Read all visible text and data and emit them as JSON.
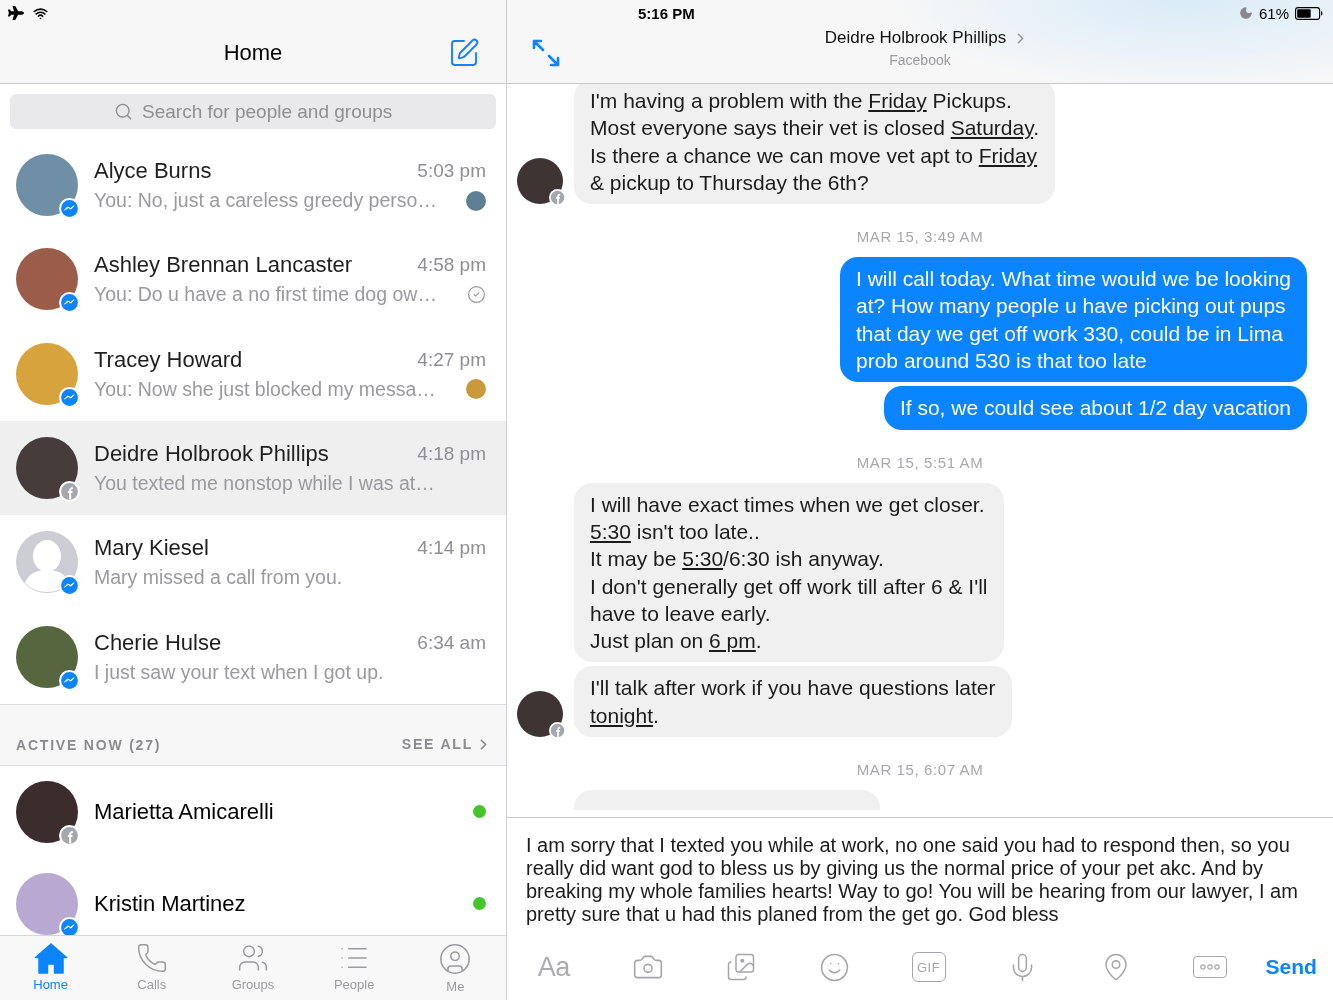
{
  "status_bar": {
    "time": "5:16 PM",
    "battery": "61%"
  },
  "sidebar": {
    "title": "Home",
    "search": {
      "placeholder": "Search for people and groups"
    },
    "conversations": [
      {
        "name": "Alyce Burns",
        "time": "5:03 pm",
        "preview": "You: No, just a careless greedy perso…",
        "photo": true,
        "facebook_user": false,
        "seen": true,
        "delivered": false,
        "selected": false
      },
      {
        "name": "Ashley Brennan Lancaster",
        "time": "4:58 pm",
        "preview": "You: Do u have a no first time dog ow…",
        "photo": true,
        "facebook_user": false,
        "seen": false,
        "delivered": true,
        "selected": false
      },
      {
        "name": "Tracey Howard",
        "time": "4:27 pm",
        "preview": "You: Now she just blocked my messa…",
        "photo": true,
        "facebook_user": false,
        "seen": true,
        "delivered": false,
        "selected": false
      },
      {
        "name": "Deidre Holbrook Phillips",
        "time": "4:18 pm",
        "preview": "You texted me nonstop while I was at…",
        "photo": true,
        "facebook_user": true,
        "seen": false,
        "delivered": false,
        "selected": true
      },
      {
        "name": "Mary Kiesel",
        "time": "4:14 pm",
        "preview": "Mary missed a call from you.",
        "photo": false,
        "facebook_user": false,
        "seen": false,
        "delivered": false,
        "selected": false
      },
      {
        "name": "Cherie Hulse",
        "time": "6:34 am",
        "preview": "I just saw your text when I got up.",
        "photo": true,
        "facebook_user": false,
        "seen": false,
        "delivered": false,
        "selected": false
      }
    ],
    "active_now": {
      "heading": "ACTIVE NOW (27)",
      "see_all": "SEE ALL",
      "people": [
        {
          "name": "Marietta Amicarelli",
          "photo": true,
          "facebook_user": true,
          "online": true
        },
        {
          "name": "Kristin Martinez",
          "photo": true,
          "facebook_user": false,
          "online": true
        }
      ]
    },
    "tabs": [
      {
        "label": "Home",
        "kind": "home",
        "selected": true
      },
      {
        "label": "Calls",
        "kind": "calls",
        "selected": false
      },
      {
        "label": "Groups",
        "kind": "groups",
        "selected": false
      },
      {
        "label": "People",
        "kind": "people",
        "selected": false
      },
      {
        "label": "Me",
        "kind": "me",
        "selected": false
      }
    ]
  },
  "chat": {
    "title": "Deidre Holbrook Phillips",
    "subtitle": "Facebook",
    "facebook_user": true,
    "messages": [
      {
        "kind": "incoming",
        "avatar": true,
        "parts": [
          {
            "text": "I'm having a problem with the ",
            "link": false
          },
          {
            "text": "Friday",
            "link": true
          },
          {
            "text": " Pickups.\nMost everyone says their vet is closed ",
            "link": false
          },
          {
            "text": "Saturday",
            "link": true
          },
          {
            "text": ".\nIs there a chance we can move vet apt to ",
            "link": false
          },
          {
            "text": "Friday",
            "link": true
          },
          {
            "text": "\n& pickup to Thursday the 6th?",
            "link": false
          }
        ]
      },
      {
        "kind": "timestamp",
        "text": "MAR 15, 3:49 AM"
      },
      {
        "kind": "outgoing",
        "parts": [
          {
            "text": "I will call today. What time would we be looking\nat? How many people u have picking out pups\nthat day we get off work 330, could be in Lima\nprob around 530 is that too late",
            "link": false
          }
        ]
      },
      {
        "kind": "outgoing",
        "parts": [
          {
            "text": "If so, we could see about 1/2 day vacation",
            "link": false
          }
        ]
      },
      {
        "kind": "timestamp",
        "text": "MAR 15, 5:51 AM"
      },
      {
        "kind": "incoming",
        "avatar": false,
        "parts": [
          {
            "text": "I will have exact times when we get closer.\n",
            "link": false
          },
          {
            "text": "5:30",
            "link": true
          },
          {
            "text": " isn't too late..\nIt may be ",
            "link": false
          },
          {
            "text": "5:30",
            "link": true
          },
          {
            "text": "/6:30 ish anyway.\nI don't generally get off work till after 6 & I'll\nhave to leave early.\nJust plan on ",
            "link": false
          },
          {
            "text": "6 pm",
            "link": true
          },
          {
            "text": ".",
            "link": false
          }
        ]
      },
      {
        "kind": "incoming",
        "avatar": true,
        "parts": [
          {
            "text": "I'll talk after work if you have questions later\n",
            "link": false
          },
          {
            "text": "tonight",
            "link": true
          },
          {
            "text": ".",
            "link": false
          }
        ]
      },
      {
        "kind": "timestamp",
        "text": "MAR 15, 6:07 AM"
      },
      {
        "kind": "cut_off"
      }
    ],
    "compose": {
      "value": "I am sorry that I texted you while at work, no one said you had to respond then, so you really did want god to bless us by giving us the normal price of your pet akc. And by breaking my whole families hearts! Way to go! You will be hearing from our lawyer, I am pretty sure that u had this planed from the get go. God bless",
      "tools": [
        {
          "kind": "text_style",
          "label": "Aa"
        },
        {
          "kind": "camera"
        },
        {
          "kind": "gallery"
        },
        {
          "kind": "emoji"
        },
        {
          "kind": "gif",
          "label": "GIF"
        },
        {
          "kind": "microphone"
        },
        {
          "kind": "location"
        },
        {
          "kind": "more"
        }
      ],
      "send": "Send"
    }
  }
}
